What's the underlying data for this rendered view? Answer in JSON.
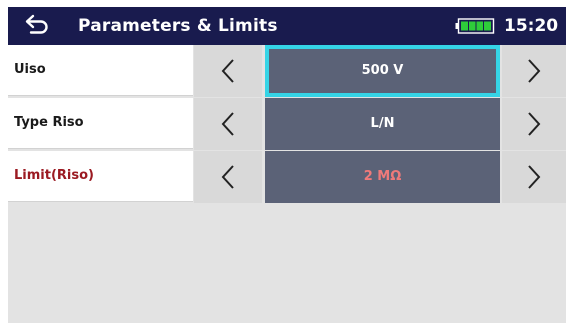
{
  "header": {
    "title": "Parameters & Limits",
    "back_icon": "back-arrow-icon",
    "battery_icon": "battery-icon",
    "battery_level": 1.0,
    "time": "15:20"
  },
  "parameters": [
    {
      "label": "Uiso",
      "value": "500 V",
      "selected": true,
      "alert": false
    },
    {
      "label": "Type Riso",
      "value": "L/N",
      "selected": false,
      "alert": false
    },
    {
      "label": "Limit(Riso)",
      "value": "2 MΩ",
      "selected": false,
      "alert": true
    }
  ],
  "icons": {
    "decrease": "chevron-left-icon",
    "increase": "chevron-right-icon"
  },
  "colors": {
    "header_bg": "#191b4e",
    "value_bg": "#5b6277",
    "selected_border": "#35d4e6",
    "alert_label": "#9b1a22",
    "alert_value": "#f07a7a"
  }
}
